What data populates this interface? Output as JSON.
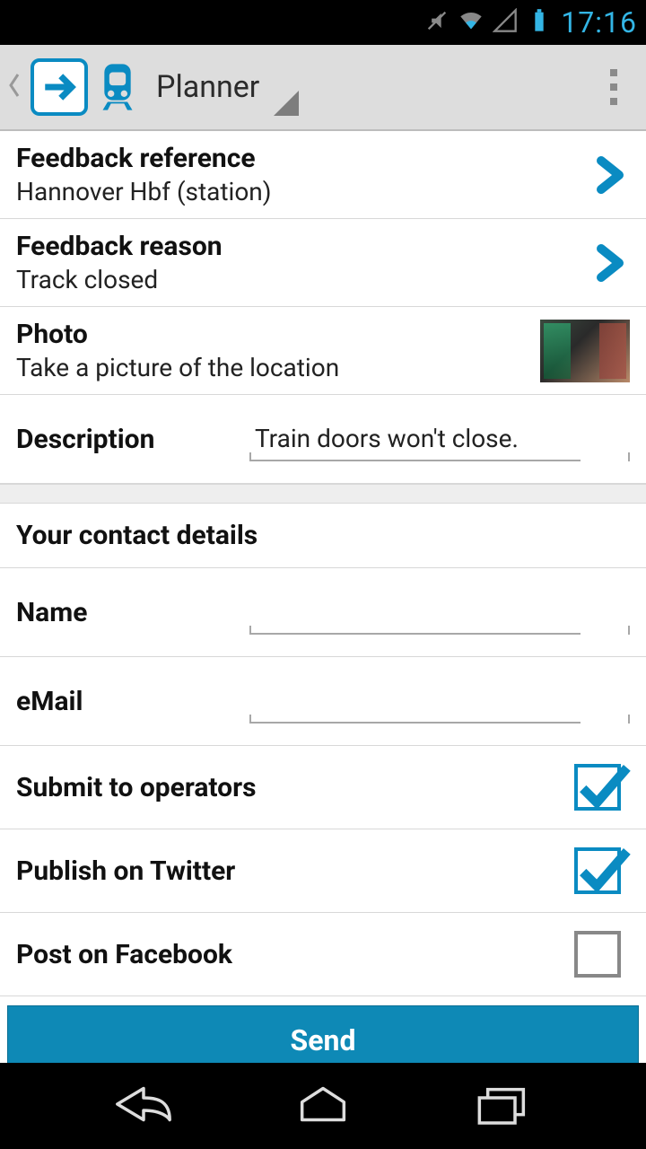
{
  "status_bar": {
    "time": "17:16"
  },
  "action_bar": {
    "title": "Planner"
  },
  "feedback_reference": {
    "title": "Feedback reference",
    "value": "Hannover Hbf (station)"
  },
  "feedback_reason": {
    "title": "Feedback reason",
    "value": "Track closed"
  },
  "photo": {
    "title": "Photo",
    "subtitle": "Take a picture of the location"
  },
  "description": {
    "label": "Description",
    "value": "Train doors won't close."
  },
  "contact": {
    "header": "Your contact details",
    "name_label": "Name",
    "name_value": "",
    "email_label": "eMail",
    "email_value": ""
  },
  "options": {
    "submit_operators": {
      "label": "Submit to operators",
      "checked": true
    },
    "publish_twitter": {
      "label": "Publish on Twitter",
      "checked": true
    },
    "post_facebook": {
      "label": "Post on Facebook",
      "checked": false
    }
  },
  "send_button": "Send"
}
